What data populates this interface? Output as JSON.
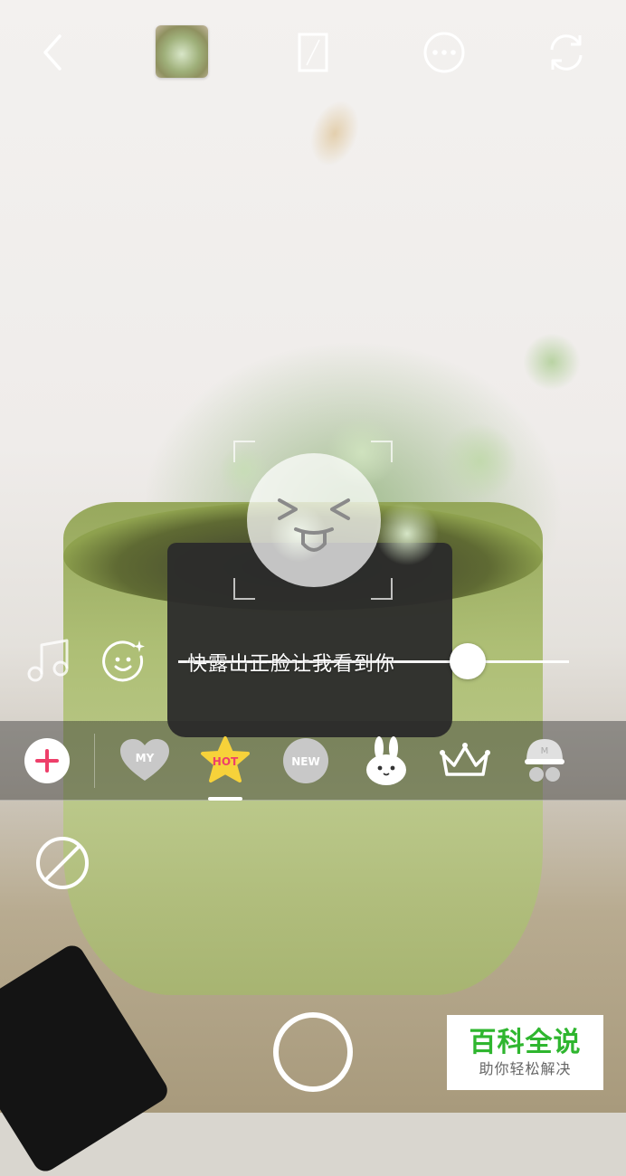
{
  "camera": {
    "hint_text": "快露出正脸让我看到你",
    "slider_level": 0.74
  },
  "top_bar": {
    "icons": [
      "back-icon",
      "gallery-thumbnail",
      "aspect-ratio-icon",
      "more-icon",
      "switch-camera-icon"
    ]
  },
  "sticker_bar": {
    "categories": [
      {
        "name": "my",
        "label": "MY",
        "icon": "heart-icon"
      },
      {
        "name": "hot",
        "label": "HOT",
        "icon": "star-icon",
        "selected": true
      },
      {
        "name": "new",
        "label": "NEW",
        "icon": "circle-badge-icon"
      },
      {
        "name": "bunny",
        "label": "",
        "icon": "bunny-icon"
      },
      {
        "name": "crown",
        "label": "",
        "icon": "crown-icon"
      },
      {
        "name": "cap",
        "label": "",
        "icon": "cap-glasses-icon"
      }
    ]
  },
  "colors": {
    "accent_pink": "#ee3f6a",
    "hot_yellow": "#f7d23a",
    "watermark_green": "#2fb62f"
  },
  "watermark": {
    "title": "百科全说",
    "subtitle": "助你轻松解决"
  }
}
